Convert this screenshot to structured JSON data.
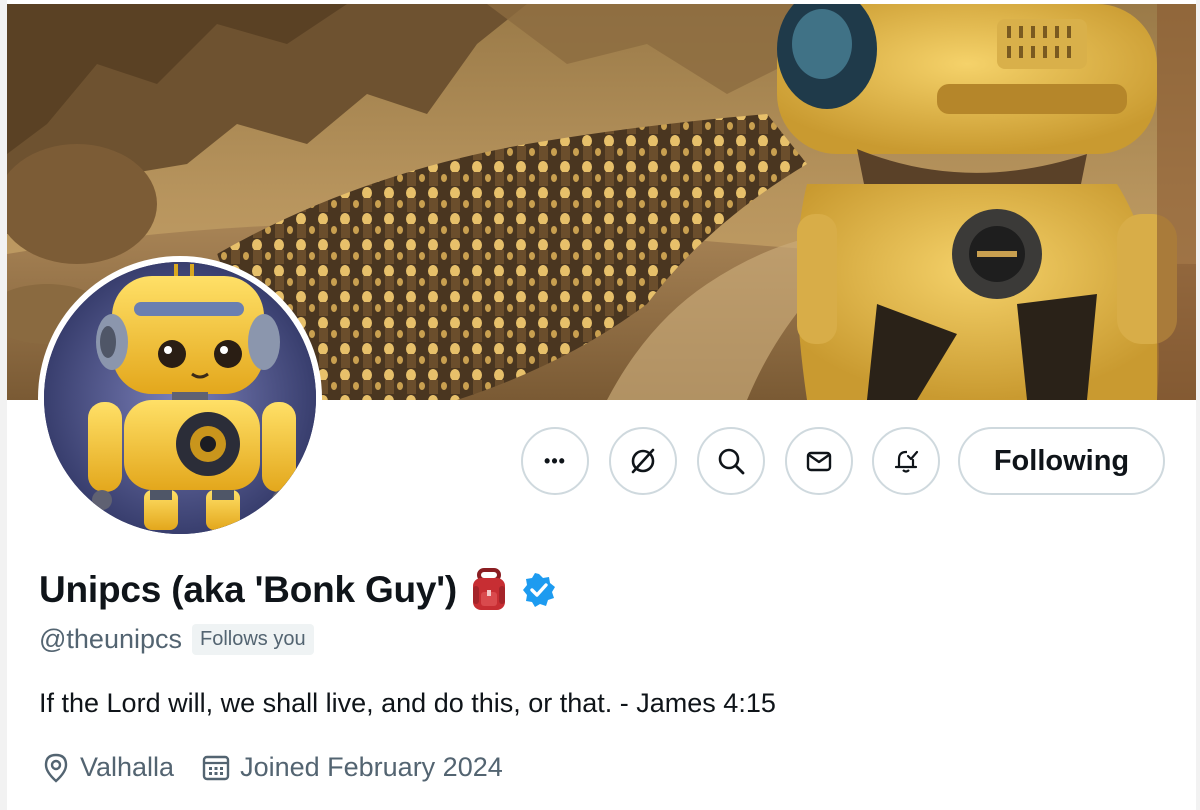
{
  "profile": {
    "display_name": "Unipcs (aka 'Bonk Guy')",
    "handle": "@theunipcs",
    "follows_you": "Follows you",
    "bio": "If the Lord will, we shall live, and do this, or that. - James 4:15",
    "location": "Valhalla",
    "joined": "Joined February 2024"
  },
  "actions": {
    "more_label": "•••",
    "following_label": "Following"
  },
  "icons": {
    "more": "more-dots-icon",
    "grok": "grok-slash-icon",
    "search": "search-icon",
    "message": "envelope-icon",
    "notifications": "bell-check-icon",
    "verified": "verified-badge-icon",
    "backpack": "backpack-emoji-icon",
    "location": "location-pin-icon",
    "calendar": "calendar-icon"
  },
  "colors": {
    "verified_blue": "#1d9bf0",
    "text_primary": "#0f1419",
    "text_secondary": "#536471",
    "border": "#cfd9de"
  }
}
